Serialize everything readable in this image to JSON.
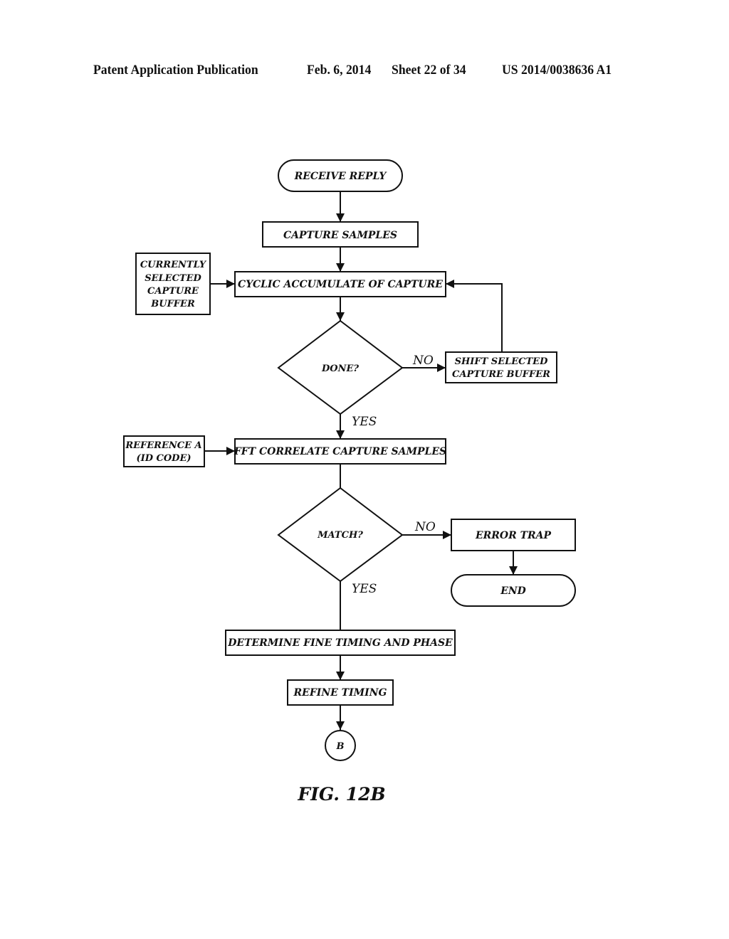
{
  "header": {
    "publication": "Patent Application Publication",
    "date": "Feb. 6, 2014",
    "sheet": "Sheet 22 of 34",
    "number": "US 2014/0038636 A1"
  },
  "figure": {
    "caption": "FIG. 12B",
    "nodes": {
      "receive_reply": "RECEIVE REPLY",
      "capture_samples": "CAPTURE SAMPLES",
      "current_buffer": [
        "CURRENTLY",
        "SELECTED",
        "CAPTURE",
        "BUFFER"
      ],
      "cyclic_accumulate": "CYCLIC ACCUMULATE OF CAPTURE",
      "done": "DONE?",
      "shift_buffer": [
        "SHIFT SELECTED",
        "CAPTURE BUFFER"
      ],
      "reference_a": [
        "REFERENCE A",
        "(ID CODE)"
      ],
      "fft_correlate": "FFT CORRELATE CAPTURE SAMPLES",
      "match": "MATCH?",
      "error_trap": "ERROR TRAP",
      "end": "END",
      "fine_timing": "DETERMINE FINE TIMING AND PHASE",
      "refine_timing": "REFINE TIMING",
      "connector_b": "B"
    },
    "edge_labels": {
      "done_no": "NO",
      "done_yes": "YES",
      "match_no": "NO",
      "match_yes": "YES"
    }
  }
}
